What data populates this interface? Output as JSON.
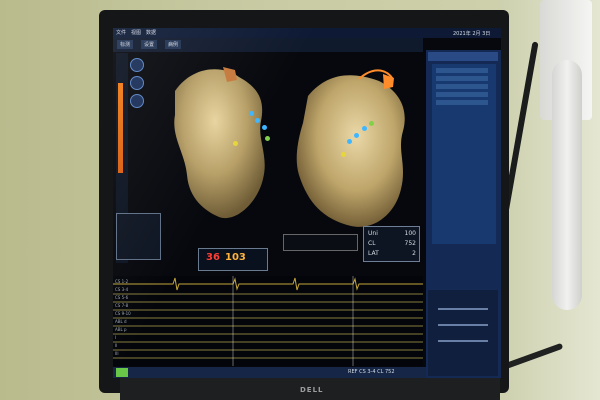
{
  "screen": {
    "menu": [
      "文件",
      "视图",
      "数据"
    ],
    "toolbar": [
      "标测",
      "设置",
      "病例"
    ],
    "date": "2021年 2月 3日",
    "readout": {
      "row1_label": "Uni",
      "row1_value": "100",
      "row2_label": "CL",
      "row2_value": "752",
      "row3_label": "LAT",
      "row3_value": "2"
    },
    "summary": {
      "value_red": "36",
      "value_orange": "103"
    },
    "status": {
      "text": "REF CS 3-4 CL 752"
    },
    "ecg_labels": [
      "CS 1-2",
      "CS 3-4",
      "CS 5-6",
      "CS 7-8",
      "CS 9-10",
      "ABL d",
      "ABL p",
      "I",
      "II",
      "III",
      "aVR",
      "aVL",
      "aVF"
    ]
  },
  "monitor": {
    "brand": "DELL"
  },
  "colors": {
    "orange": "#f27c16",
    "red_value": "#ff3e35",
    "yellow_value": "#ffb33b",
    "blue_marker": "#3fb6ff",
    "panel_blue": "#142a55"
  }
}
